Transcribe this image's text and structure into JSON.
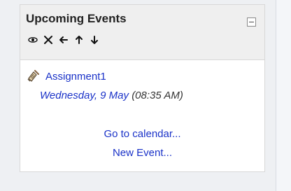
{
  "block": {
    "title": "Upcoming Events"
  },
  "controls": [
    {
      "name": "show-hide-icon"
    },
    {
      "name": "delete-icon"
    },
    {
      "name": "move-left-icon"
    },
    {
      "name": "move-up-icon"
    },
    {
      "name": "move-down-icon"
    }
  ],
  "event": {
    "name": "Assignment1",
    "date": "Wednesday, 9 May",
    "time": "(08:35 AM)"
  },
  "links": {
    "calendar": "Go to calendar...",
    "new_event": "New Event..."
  },
  "colors": {
    "link": "#1a32c8",
    "header_bg": "#efefef",
    "page_bg": "#eef0f3"
  }
}
